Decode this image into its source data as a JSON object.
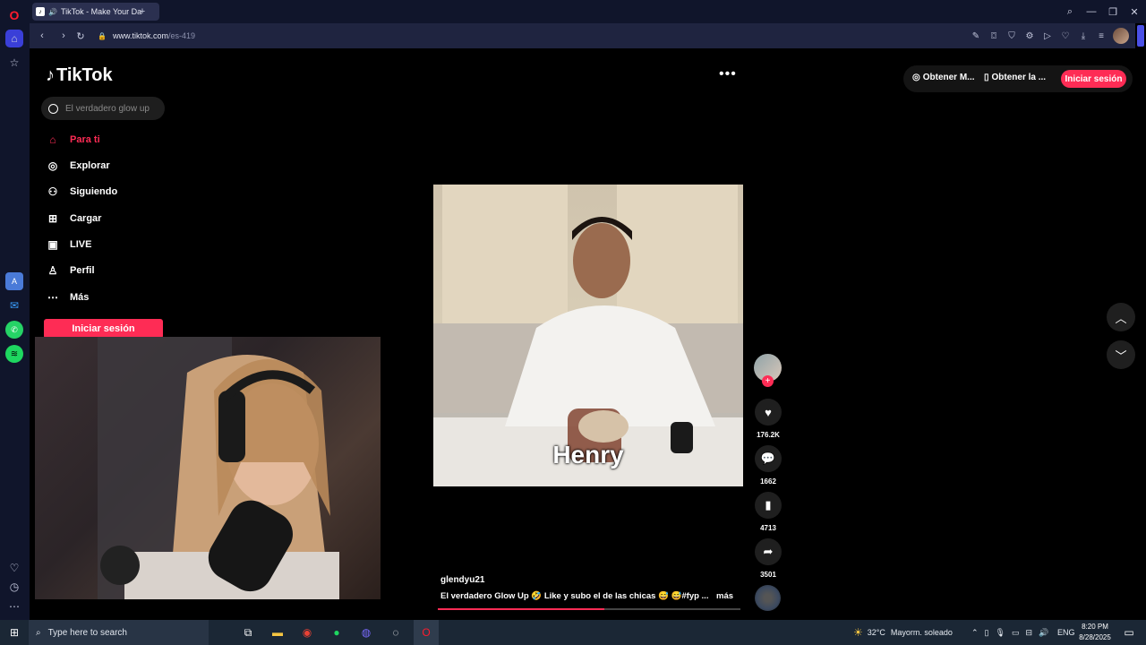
{
  "browser": {
    "tab_title": "TikTok - Make Your Da",
    "new_tab": "+",
    "url_host": "www.tiktok.com",
    "url_path": "/es-419"
  },
  "tiktok": {
    "logo": "TikTok",
    "search_placeholder": "El verdadero glow up",
    "nav": [
      {
        "label": "Para ti",
        "icon": "home-icon"
      },
      {
        "label": "Explorar",
        "icon": "compass-icon"
      },
      {
        "label": "Siguiendo",
        "icon": "following-icon"
      },
      {
        "label": "Cargar",
        "icon": "upload-icon"
      },
      {
        "label": "LIVE",
        "icon": "live-icon"
      },
      {
        "label": "Perfil",
        "icon": "profile-icon"
      },
      {
        "label": "Más",
        "icon": "more-icon"
      }
    ],
    "side_login": "Iniciar sesión",
    "top_more": "•••",
    "get_coins": "Obtener M...",
    "get_app": "Obtener la ...",
    "top_login": "Iniciar sesión",
    "video_caption": "Henry",
    "likes": "176.2K",
    "comments": "1662",
    "saves": "4713",
    "shares": "3501",
    "author": "glendyu21",
    "description": "El verdadero Glow Up 🤣 Like y subo el de las chicas 😅 😅#fyp ...",
    "more": "más",
    "progress": 0.55
  },
  "taskbar": {
    "search_placeholder": "Type here to search",
    "weather_temp": "32°C",
    "weather_text": "Mayorm. soleado",
    "lang": "ENG",
    "time": "8:20 PM",
    "date": "8/28/2025"
  },
  "colors": {
    "accent": "#fe2c55",
    "sidebar": "#10152b",
    "addressbar": "#1f2440",
    "taskbar": "#1b2735"
  }
}
